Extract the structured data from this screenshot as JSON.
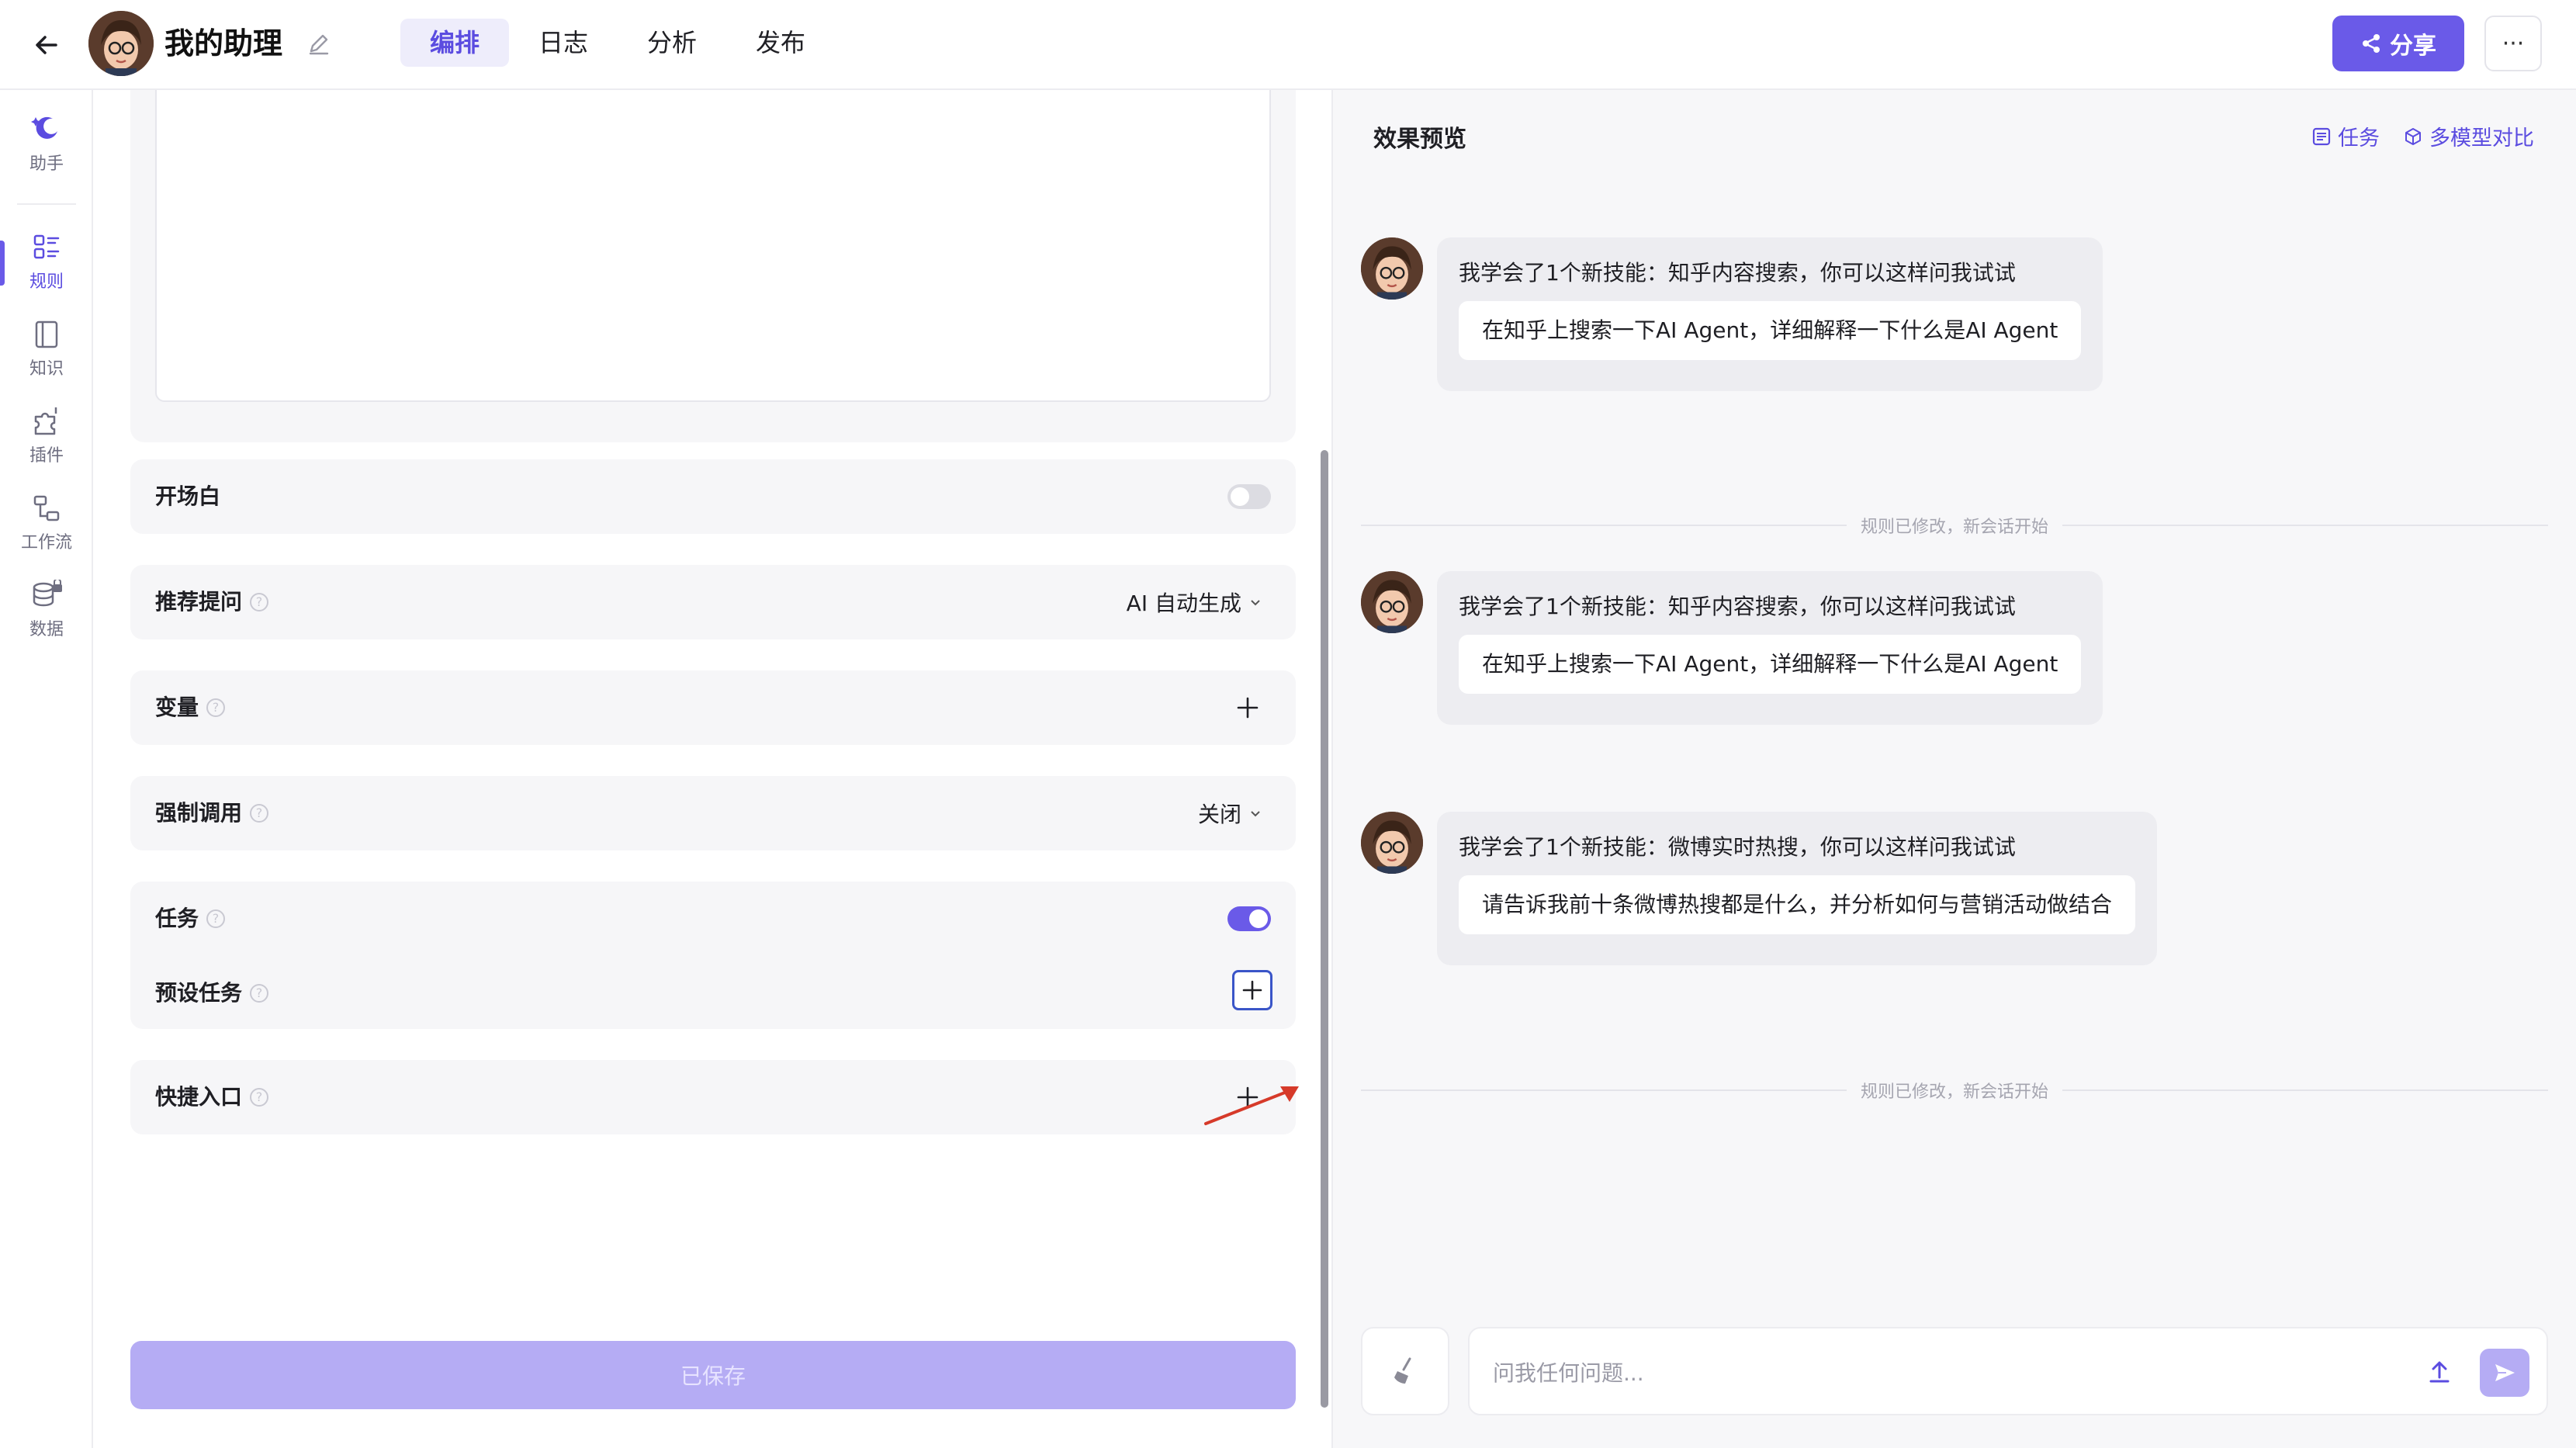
{
  "header": {
    "title": "我的助理",
    "tabs": [
      {
        "label": "编排",
        "active": true
      },
      {
        "label": "日志",
        "active": false
      },
      {
        "label": "分析",
        "active": false
      },
      {
        "label": "发布",
        "active": false
      }
    ],
    "share_label": "分享",
    "more_label": "···"
  },
  "sidebar": {
    "items": [
      {
        "label": "助手",
        "icon": "assistant-icon",
        "active": false
      },
      {
        "label": "规则",
        "icon": "rules-icon",
        "active": true
      },
      {
        "label": "知识",
        "icon": "knowledge-icon",
        "active": false
      },
      {
        "label": "插件",
        "icon": "plugin-icon",
        "active": false
      },
      {
        "label": "工作流",
        "icon": "workflow-icon",
        "active": false
      },
      {
        "label": "数据",
        "icon": "database-lock-icon",
        "active": false
      }
    ]
  },
  "config": {
    "opening": {
      "label": "开场白",
      "enabled": false
    },
    "suggest": {
      "label": "推荐提问",
      "value": "AI 自动生成"
    },
    "variables": {
      "label": "变量"
    },
    "force_call": {
      "label": "强制调用",
      "value": "关闭"
    },
    "tasks": {
      "label": "任务",
      "enabled": true,
      "preset_label": "预设任务"
    },
    "shortcuts": {
      "label": "快捷入口"
    },
    "save_label": "已保存"
  },
  "preview": {
    "title": "效果预览",
    "actions": [
      {
        "label": "任务",
        "icon": "task-icon"
      },
      {
        "label": "多模型对比",
        "icon": "cube-icon"
      }
    ],
    "messages": [
      {
        "text": "我学会了1个新技能：知乎内容搜索，你可以这样问我试试",
        "suggestion": "在知乎上搜索一下AI Agent，详细解释一下什么是AI Agent"
      },
      {
        "text": "我学会了1个新技能：知乎内容搜索，你可以这样问我试试",
        "suggestion": "在知乎上搜索一下AI Agent，详细解释一下什么是AI Agent"
      },
      {
        "text": "我学会了1个新技能：微博实时热搜，你可以这样问我试试",
        "suggestion": "请告诉我前十条微博热搜都是什么，并分析如何与营销活动做结合"
      }
    ],
    "divider_note": "规则已修改，新会话开始",
    "input_placeholder": "问我任何问题..."
  },
  "colors": {
    "accent": "#6a5ae8",
    "accent_light": "#b5acf4",
    "panel_bg": "#f6f6f8",
    "annotation_arrow": "#d63a2a"
  }
}
